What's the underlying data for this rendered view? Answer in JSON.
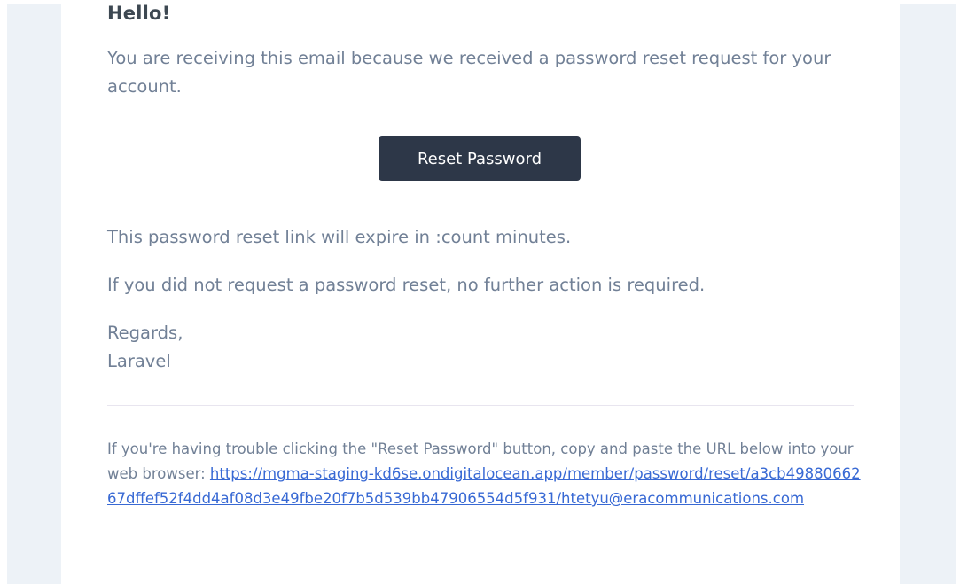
{
  "email": {
    "greeting": "Hello!",
    "intro": "You are receiving this email because we received a password reset request for your account.",
    "button_label": "Reset Password",
    "expiry_note": "This password reset link will expire in :count minutes.",
    "no_action_note": "If you did not request a password reset, no further action is required.",
    "salutation": "Regards,",
    "signature": "Laravel",
    "subcopy_text": "If you're having trouble clicking the \"Reset Password\" button, copy and paste the URL below into your web browser:",
    "reset_url": "https://mgma-staging-kd6se.ondigitalocean.app/member/password/reset/a3cb4988066267dffef52f4dd4af08d3e49fbe20f7b5d539bb47906554d5f931/htetyu@eracommunications.com"
  },
  "colors": {
    "background": "#edf2f7",
    "card": "#ffffff",
    "heading": "#3d4852",
    "body_text": "#718096",
    "button": "#2d3748",
    "button_text": "#ffffff",
    "link": "#3869d4",
    "divider": "#e8e5ef"
  }
}
